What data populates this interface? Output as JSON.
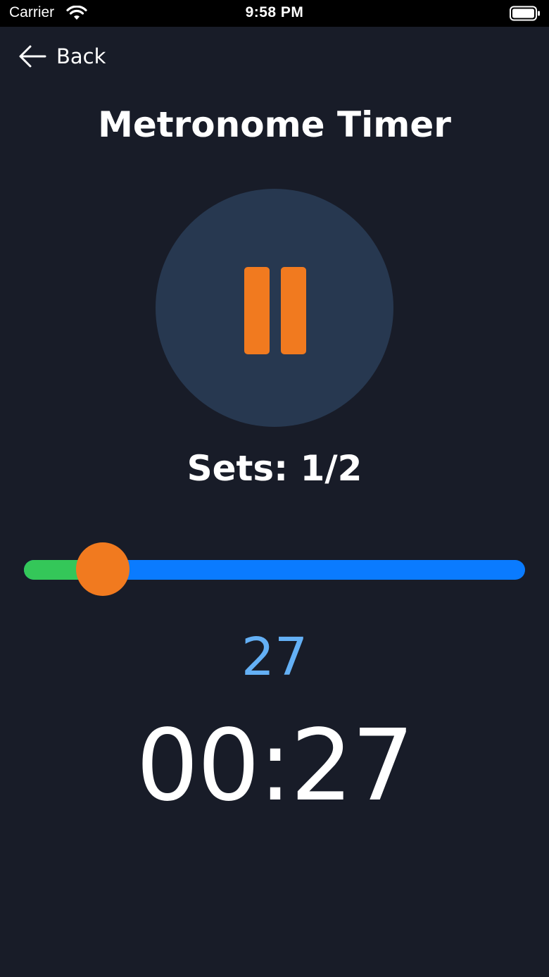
{
  "status_bar": {
    "carrier": "Carrier",
    "time": "9:58 PM",
    "icons": [
      "wifi-icon",
      "battery-icon"
    ]
  },
  "nav": {
    "back_label": "Back",
    "back_icon": "arrow-left-icon"
  },
  "page": {
    "title": "Metronome Timer"
  },
  "control": {
    "state_icon": "pause-icon"
  },
  "sets": {
    "label": "Sets: 1/2"
  },
  "progress_slider": {
    "value_fraction": 0.157
  },
  "counter": {
    "beat": "27",
    "elapsed": "00:27"
  },
  "colors": {
    "background": "#181c28",
    "status_bar": "#000000",
    "button_circle": "#273850",
    "accent_orange": "#f17a1f",
    "slider_filled": "#34c759",
    "slider_track": "#0a7bff",
    "beat_text": "#64b0f5",
    "text": "#ffffff"
  }
}
